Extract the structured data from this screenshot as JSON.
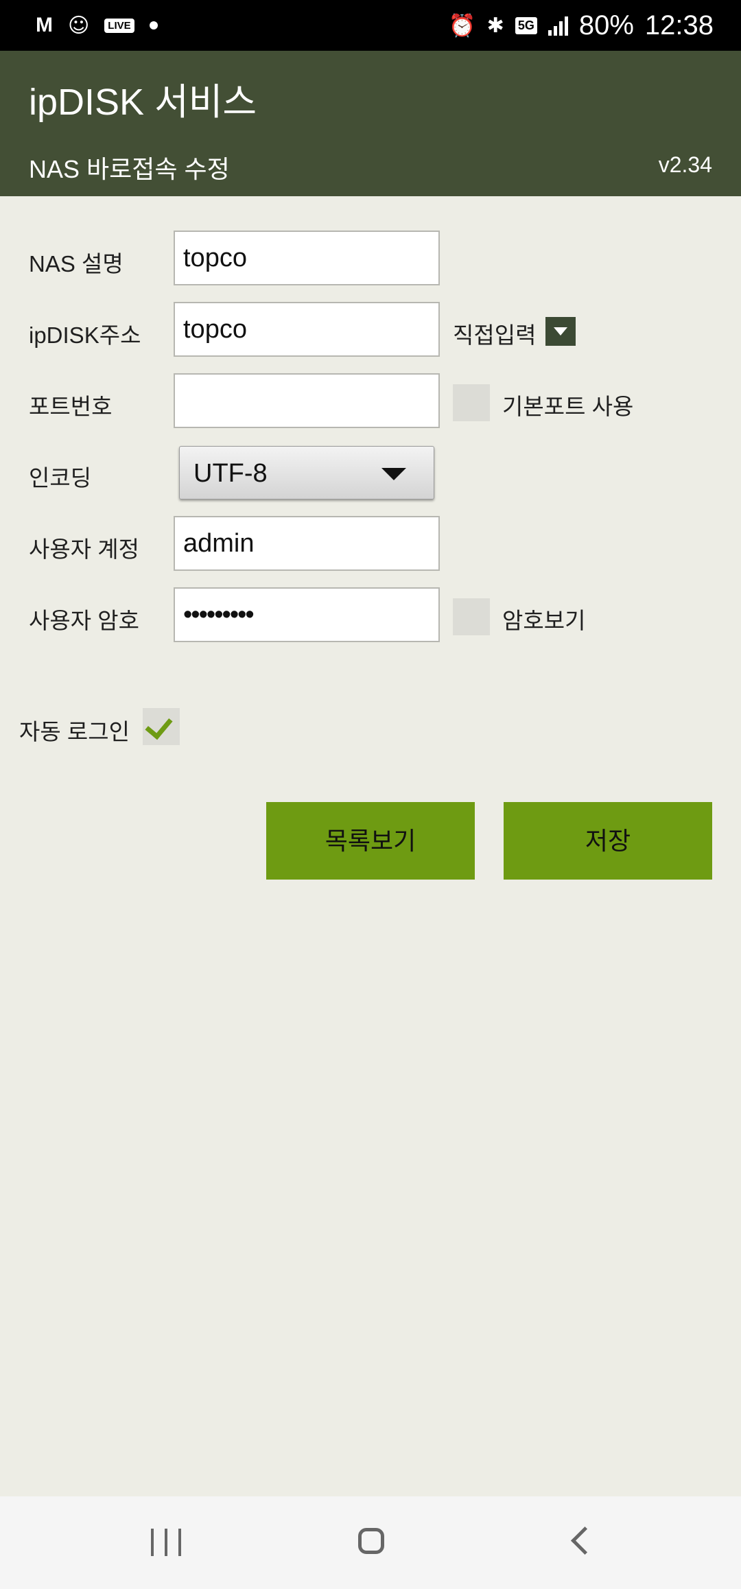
{
  "status_bar": {
    "left_icons": [
      "M",
      "app-icon",
      "LIVE",
      "dot"
    ],
    "network": "5G",
    "battery": "80%",
    "time": "12:38"
  },
  "app_bar": {
    "title": "ipDISK 서비스",
    "subtitle": "NAS 바로접속 수정",
    "version": "v2.34"
  },
  "form": {
    "nas_desc_label": "NAS 설명",
    "nas_desc_value": "topco",
    "ipdisk_label": "ipDISK주소",
    "ipdisk_value": "topco",
    "direct_input_label": "직접입력",
    "port_label": "포트번호",
    "port_value": "",
    "default_port_label": "기본포트 사용",
    "default_port_checked": false,
    "encoding_label": "인코딩",
    "encoding_value": "UTF-8",
    "account_label": "사용자 계정",
    "account_value": "admin",
    "password_label": "사용자 암호",
    "password_value": "•••••••••",
    "show_password_label": "암호보기",
    "show_password_checked": false,
    "auto_login_label": "자동 로그인",
    "auto_login_checked": true
  },
  "buttons": {
    "list_label": "목록보기",
    "save_label": "저장"
  },
  "colors": {
    "app_bar": "#434f35",
    "background": "#edede5",
    "button": "#6e9b12",
    "check": "#6e9b13"
  }
}
